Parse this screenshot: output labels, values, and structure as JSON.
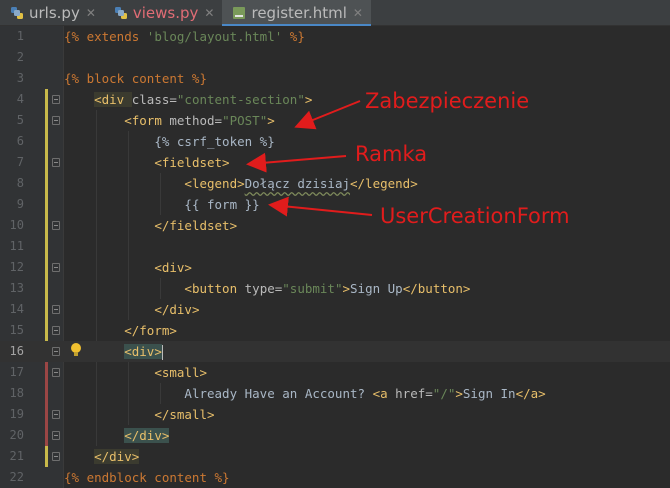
{
  "tabs": [
    {
      "label": "urls.py",
      "icon": "python-file-icon",
      "state": "inactive"
    },
    {
      "label": "views.py",
      "icon": "python-file-icon",
      "state": "modified"
    },
    {
      "label": "register.html",
      "icon": "html-file-icon",
      "state": "active"
    }
  ],
  "line_numbers": [
    "1",
    "2",
    "3",
    "4",
    "5",
    "6",
    "7",
    "8",
    "9",
    "10",
    "11",
    "12",
    "13",
    "14",
    "15",
    "16",
    "17",
    "18",
    "19",
    "20",
    "21",
    "22"
  ],
  "code": {
    "l1": {
      "a": "{% extends ",
      "b": "'blog/layout.html'",
      "c": " %}"
    },
    "l3": {
      "a": "{% block content %}"
    },
    "l4": {
      "open": "<div ",
      "attr": "class=",
      "val": "\"content-section\"",
      "close": ">"
    },
    "l5": {
      "open": "<form ",
      "attr": "method=",
      "val": "\"POST\"",
      "close": ">"
    },
    "l6": {
      "a": "{% csrf_token %}"
    },
    "l7": {
      "tag": "<fieldset>"
    },
    "l8": {
      "open": "<legend>",
      "text": "Dołącz dzisiaj",
      "close": "</legend>"
    },
    "l9": {
      "a": "{{ form }}"
    },
    "l10": {
      "tag": "</fieldset>"
    },
    "l12": {
      "tag": "<div>"
    },
    "l13": {
      "open": "<button ",
      "attr": "type=",
      "val": "\"submit\"",
      "close": ">",
      "text": "Sign Up",
      "end": "</button>"
    },
    "l14": {
      "tag": "</div>"
    },
    "l15": {
      "tag": "</form>"
    },
    "l16": {
      "tag": "<div>"
    },
    "l17": {
      "tag": "<small>"
    },
    "l18": {
      "text": "Already Have an Account? ",
      "open": "<a ",
      "attr": "href=",
      "val": "\"/\"",
      "close": ">",
      "link": "Sign In",
      "end": "</a>"
    },
    "l19": {
      "tag": "</small>"
    },
    "l20": {
      "tag": "</div>"
    },
    "l21": {
      "tag": "</div>"
    },
    "l22": {
      "a": "{% endblock content %}"
    }
  },
  "annotations": {
    "zab": "Zabezpieczenie",
    "ramka": "Ramka",
    "ucf": "UserCreationForm"
  },
  "colors": {
    "annotation": "#e11c1c",
    "active_tab_underline": "#4a88c7",
    "change_bar_added": "#c8b94a",
    "change_bar_modified": "#9b4645"
  }
}
